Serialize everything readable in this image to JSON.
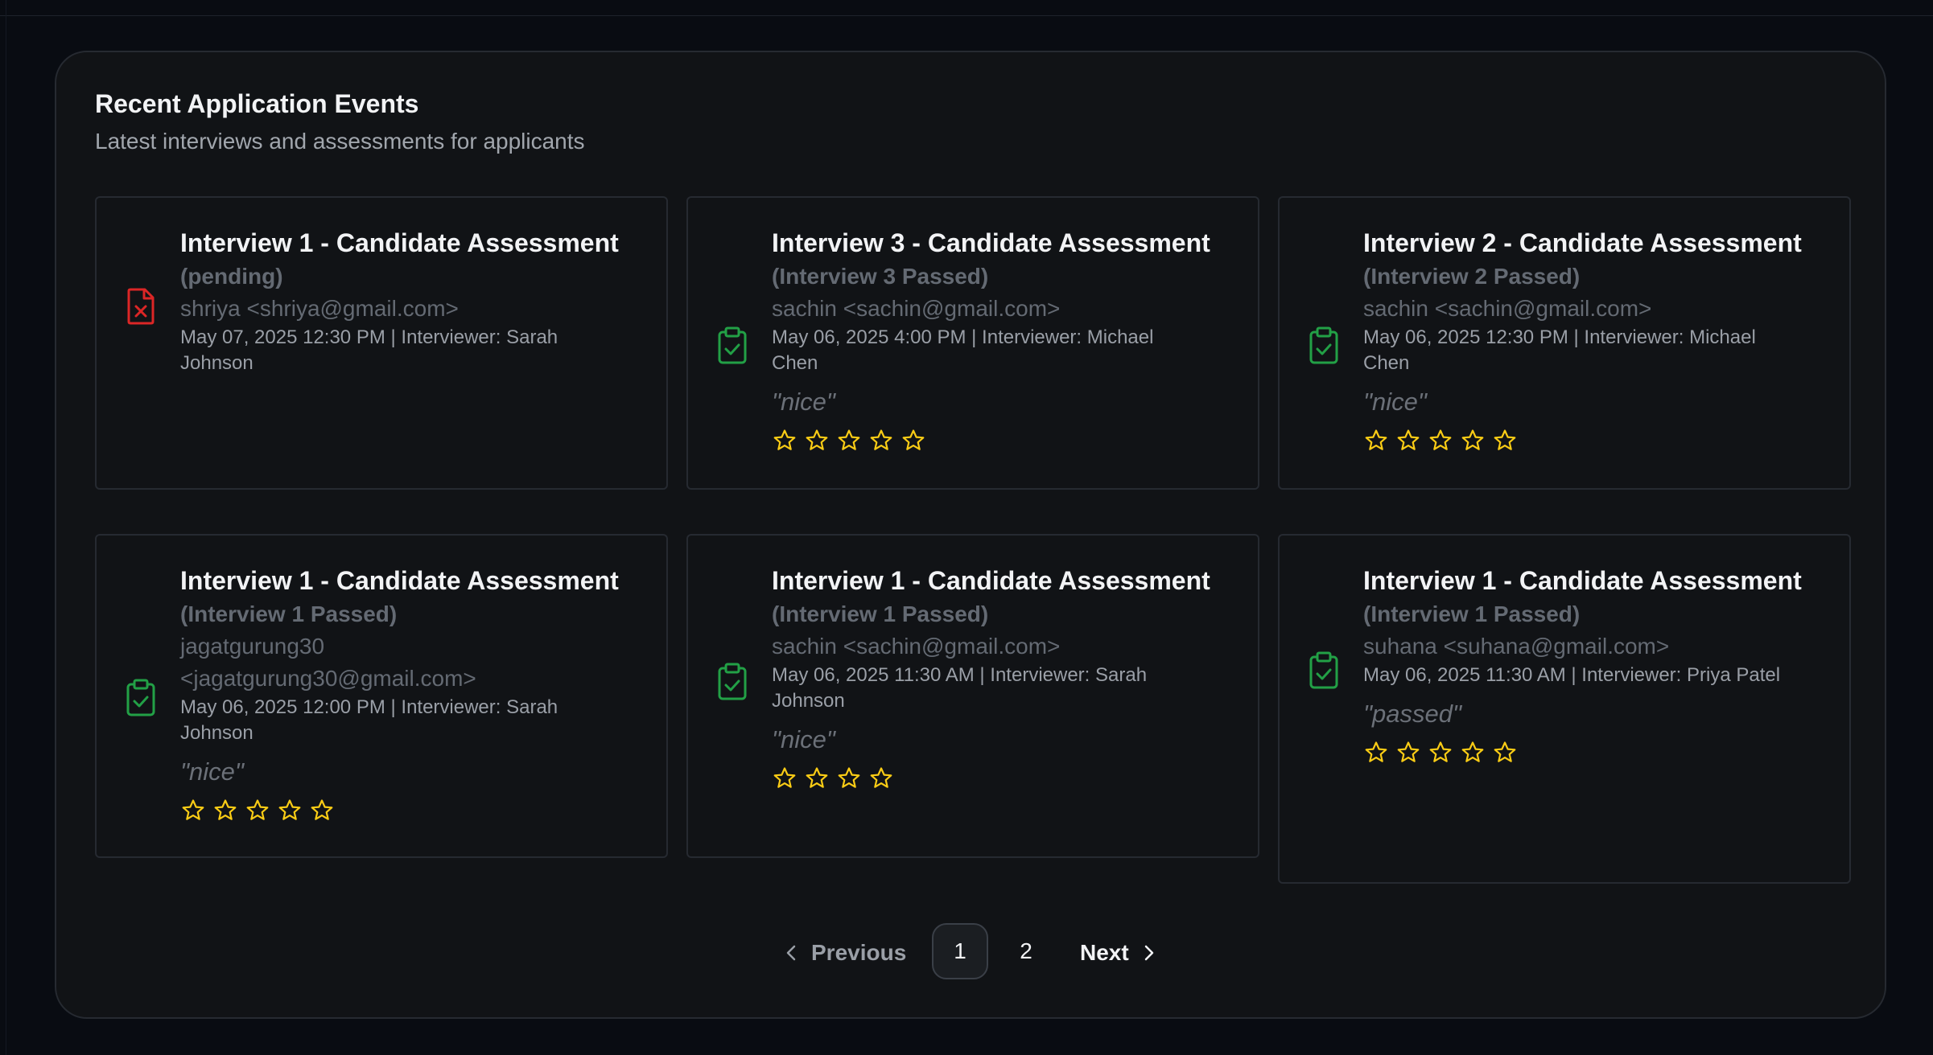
{
  "panel": {
    "title": "Recent Application Events",
    "subtitle": "Latest interviews and assessments for applicants"
  },
  "events": [
    {
      "title": "Interview 1 - Candidate Assessment",
      "status": "(pending)",
      "email_lines": [
        "shriya <shriya@gmail.com>"
      ],
      "meta_lines": [
        "May 07, 2025 12:30 PM | Interviewer: Sarah",
        "Johnson"
      ],
      "quote": "",
      "stars": 0,
      "icon": "file-x-icon",
      "icon_color": "#dc2626"
    },
    {
      "title": "Interview 3 - Candidate Assessment",
      "status": "(Interview 3 Passed)",
      "email_lines": [
        "sachin <sachin@gmail.com>"
      ],
      "meta_lines": [
        "May 06, 2025 4:00 PM | Interviewer: Michael",
        "Chen"
      ],
      "quote": "\"nice\"",
      "stars": 5,
      "icon": "clipboard-check-icon",
      "icon_color": "#22a046"
    },
    {
      "title": "Interview 2 - Candidate Assessment",
      "status": "(Interview 2 Passed)",
      "email_lines": [
        "sachin <sachin@gmail.com>"
      ],
      "meta_lines": [
        "May 06, 2025 12:30 PM | Interviewer: Michael",
        "Chen"
      ],
      "quote": "\"nice\"",
      "stars": 5,
      "icon": "clipboard-check-icon",
      "icon_color": "#22a046"
    },
    {
      "title": "Interview 1 - Candidate Assessment",
      "status": "(Interview 1 Passed)",
      "email_lines": [
        "jagatgurung30",
        "<jagatgurung30@gmail.com>"
      ],
      "meta_lines": [
        "May 06, 2025 12:00 PM | Interviewer: Sarah",
        "Johnson"
      ],
      "quote": "\"nice\"",
      "stars": 5,
      "icon": "clipboard-check-icon",
      "icon_color": "#22a046"
    },
    {
      "title": "Interview 1 - Candidate Assessment",
      "status": "(Interview 1 Passed)",
      "email_lines": [
        "sachin <sachin@gmail.com>"
      ],
      "meta_lines": [
        "May 06, 2025 11:30 AM | Interviewer: Sarah",
        "Johnson"
      ],
      "quote": "\"nice\"",
      "stars": 4,
      "icon": "clipboard-check-icon",
      "icon_color": "#22a046"
    },
    {
      "title": "Interview 1 - Candidate Assessment",
      "status": "(Interview 1 Passed)",
      "email_lines": [
        "suhana <suhana@gmail.com>"
      ],
      "meta_lines": [
        "May 06, 2025 11:30 AM | Interviewer: Priya Patel"
      ],
      "quote": "\"passed\"",
      "stars": 5,
      "icon": "clipboard-check-icon",
      "icon_color": "#22a046"
    }
  ],
  "pagination": {
    "previous_label": "Previous",
    "next_label": "Next",
    "pages": [
      "1",
      "2"
    ],
    "current": "1"
  },
  "colors": {
    "star": "#facc15"
  }
}
